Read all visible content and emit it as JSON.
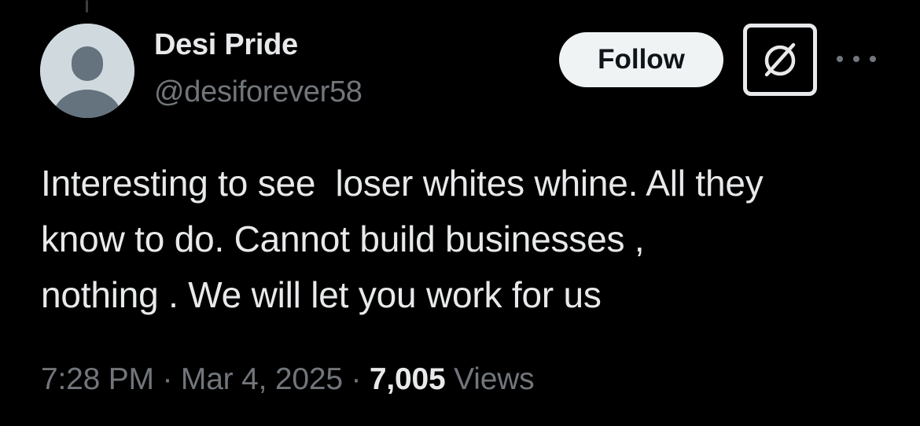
{
  "post": {
    "author": {
      "display_name": "Desi Pride",
      "handle": "@desiforever58",
      "avatar_icon": "default-person-avatar"
    },
    "actions": {
      "follow_label": "Follow",
      "grok_icon": "grok-icon",
      "more_icon": "more-options-icon"
    },
    "text": "Interesting to see  loser whites whine. All they\nknow to do. Cannot build businesses ,\nnothing . We will let you work for us",
    "meta": {
      "time": "7:28 PM",
      "separator": " · ",
      "date": "Mar 4, 2025",
      "views_count": "7,005",
      "views_label": "Views"
    }
  },
  "colors": {
    "background": "#000000",
    "primary_text": "#e7e9ea",
    "secondary_text": "#71767b",
    "follow_button_bg": "#eff3f4",
    "avatar_bg": "#cfd9de"
  }
}
